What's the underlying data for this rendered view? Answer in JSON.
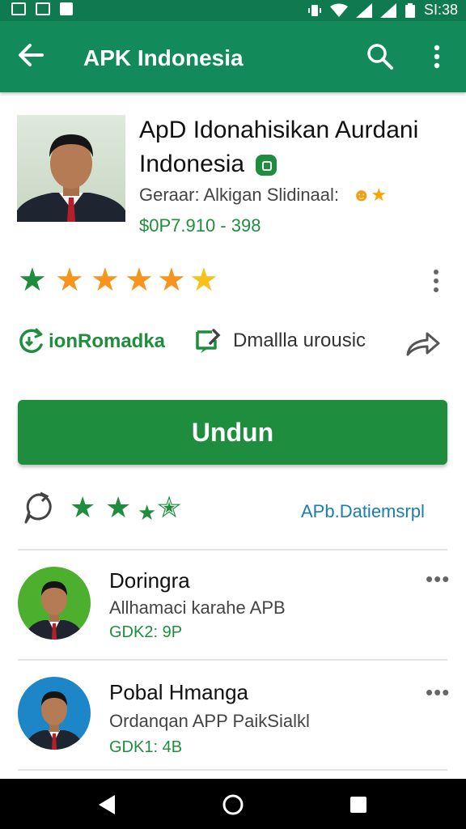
{
  "status_bar": {
    "time": "SI:38"
  },
  "app_bar": {
    "title": "APK Indonesia"
  },
  "app": {
    "name_line1": "ApD Idonahisikan Aurdani",
    "name_line2": "Indonesia",
    "subtitle": "Geraar: Alkigan Slidinaal:",
    "price": "$0P7.910 - 398"
  },
  "actions": {
    "action1": "ionRomadka",
    "action2": "Dmallla urousic"
  },
  "install_button": {
    "label": "Undun"
  },
  "meta": {
    "link": "APb.Datiemsrpl"
  },
  "list_items": [
    {
      "title": "Doringra",
      "subtitle": "Allhamaci karahe APB",
      "price": "GDK2: 9P"
    },
    {
      "title": "Pobal Hmanga",
      "subtitle": "Ordanqan APP PaikSialkl",
      "price": "GDK1: 4B"
    }
  ],
  "colors": {
    "status_bar": "#0f7a4f",
    "app_bar": "#138a5a",
    "primary": "#1e8e3e",
    "star_orange": "#f7941d",
    "star_yellow": "#f6c21a",
    "link_blue": "#1a7db0"
  },
  "icons": {
    "back": "arrow-left-icon",
    "search": "search-icon",
    "overflow": "more-vert-icon",
    "share": "share-icon"
  }
}
